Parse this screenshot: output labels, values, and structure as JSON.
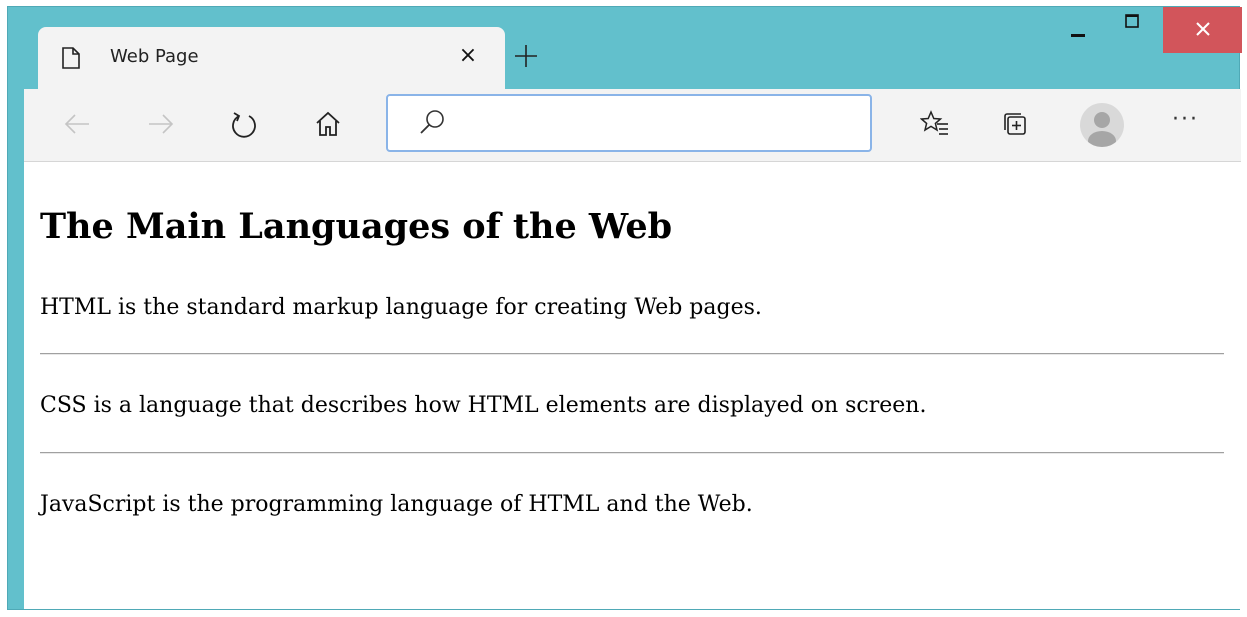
{
  "tab": {
    "title": "Web Page",
    "close": "×"
  },
  "toolbar": {
    "search": {
      "placeholder": "",
      "value": ""
    },
    "more": "···"
  },
  "page": {
    "heading": "The Main Languages of the Web",
    "paragraphs": [
      "HTML is the standard markup language for creating Web pages.",
      "CSS is a language that describes how HTML elements are displayed on screen.",
      "JavaScript is the programming language of HTML and the Web."
    ]
  },
  "colors": {
    "frame": "#62c0cc",
    "close_button": "#d2555b",
    "search_border": "#8ab4e8",
    "toolbar_bg": "#f3f3f3"
  },
  "icons": [
    "document-icon",
    "close-icon",
    "plus-icon",
    "minimize-icon",
    "maximize-icon",
    "back-icon",
    "forward-icon",
    "refresh-icon",
    "home-icon",
    "search-icon",
    "favorites-icon",
    "collections-icon",
    "profile-icon",
    "more-icon"
  ]
}
